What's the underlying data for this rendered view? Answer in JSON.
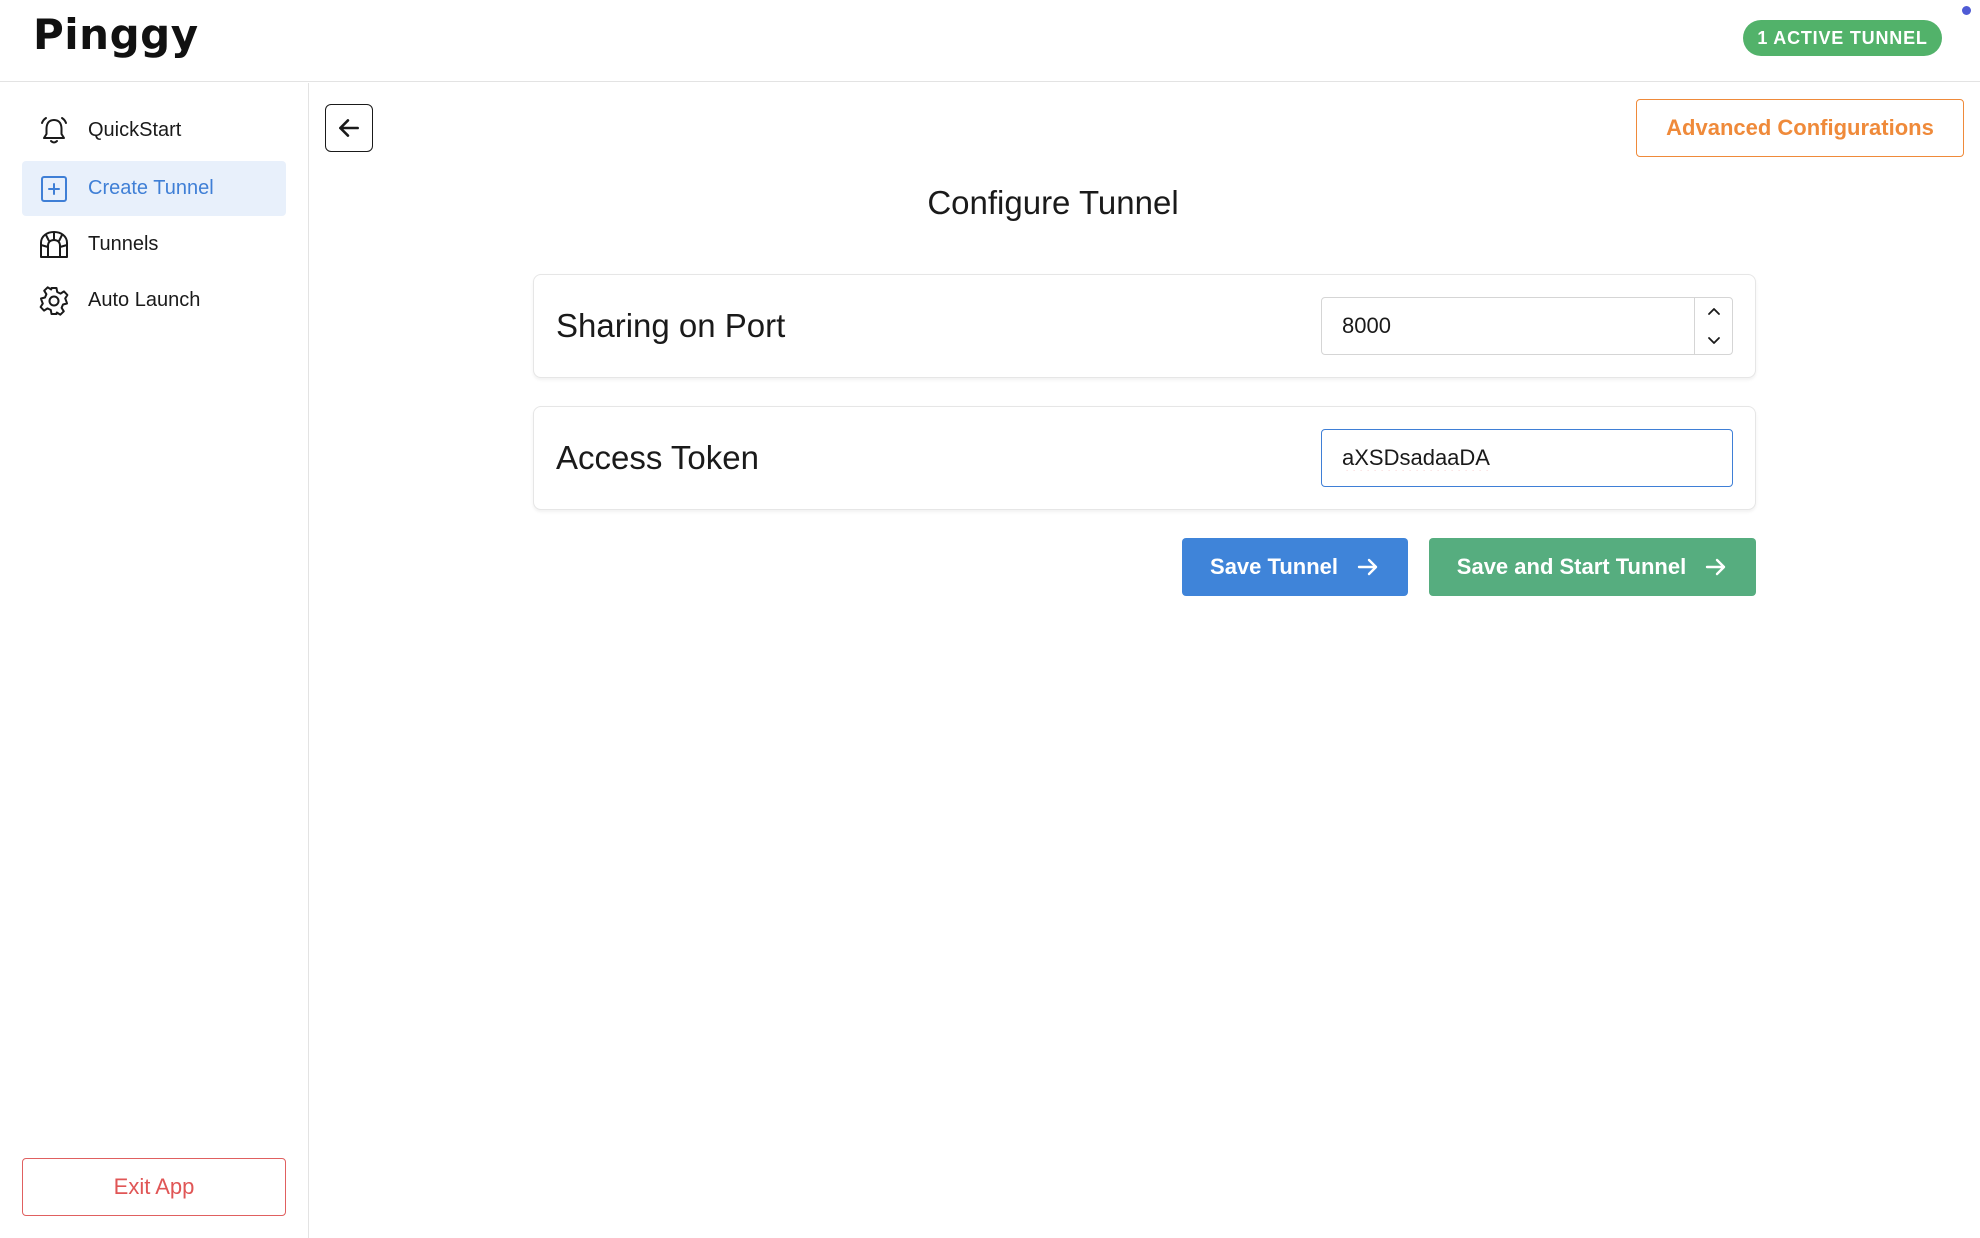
{
  "header": {
    "logo": "Pinggy",
    "badge": "1 ACTIVE TUNNEL"
  },
  "sidebar": {
    "items": [
      {
        "label": "QuickStart",
        "icon": "bell-icon",
        "active": false
      },
      {
        "label": "Create Tunnel",
        "icon": "plus-square-icon",
        "active": true
      },
      {
        "label": "Tunnels",
        "icon": "tunnel-icon",
        "active": false
      },
      {
        "label": "Auto Launch",
        "icon": "gear-icon",
        "active": false
      }
    ],
    "exit_label": "Exit App"
  },
  "toolbar": {
    "back_icon": "arrow-left-icon",
    "advanced_label": "Advanced Configurations"
  },
  "main": {
    "title": "Configure Tunnel",
    "port": {
      "label": "Sharing on Port",
      "value": "8000"
    },
    "token": {
      "label": "Access Token",
      "value": "aXSDsadaaDA"
    },
    "save_label": "Save Tunnel",
    "save_start_label": "Save and Start Tunnel"
  },
  "colors": {
    "accent_blue": "#3f84d9",
    "accent_green": "#56ad7f",
    "badge_green": "#52b26a",
    "orange": "#ef8a3a",
    "danger_red": "#e05656"
  }
}
